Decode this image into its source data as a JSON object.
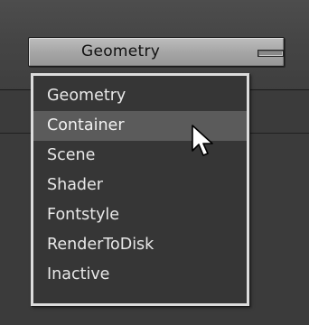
{
  "dropdown": {
    "selected_label": "Geometry",
    "toggle_icon": "collapse-bar-icon"
  },
  "menu": {
    "items": [
      {
        "label": "Geometry",
        "highlighted": false
      },
      {
        "label": "Container",
        "highlighted": true
      },
      {
        "label": "Scene",
        "highlighted": false
      },
      {
        "label": "Shader",
        "highlighted": false
      },
      {
        "label": "Fontstyle",
        "highlighted": false
      },
      {
        "label": "RenderToDisk",
        "highlighted": false
      },
      {
        "label": "Inactive",
        "highlighted": false
      }
    ]
  },
  "colors": {
    "background": "#3b3b3b",
    "button": "#a8a8a8",
    "menu_background": "#363636",
    "menu_border": "#dcdcdc",
    "highlight": "#5b5b5b",
    "menu_text": "#e8e8e8"
  },
  "cursor": {
    "icon": "mouse-pointer-icon"
  }
}
